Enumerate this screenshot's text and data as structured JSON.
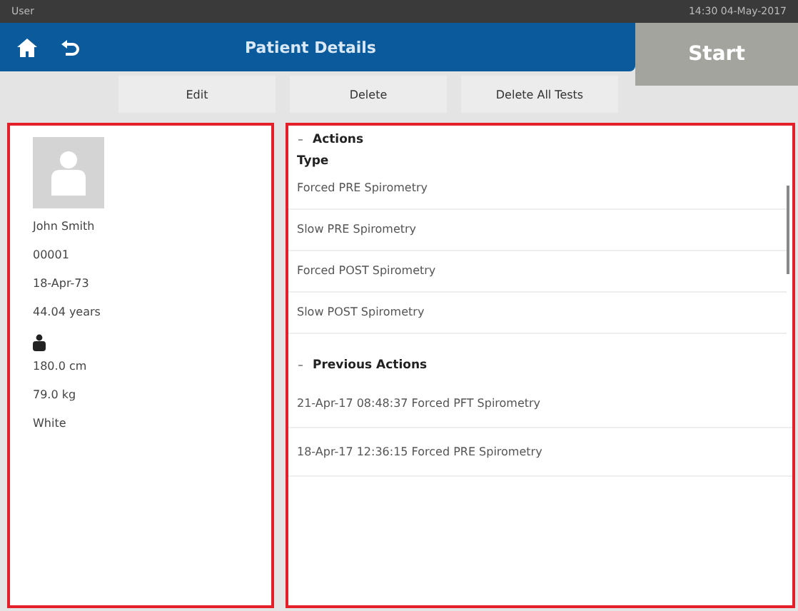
{
  "status_bar": {
    "user": "User",
    "datetime": "14:30 04-May-2017"
  },
  "header": {
    "title": "Patient Details",
    "start_button": {
      "label": "Start",
      "disabled": true
    }
  },
  "toolbar": [
    "Edit",
    "Delete",
    "Delete All Tests"
  ],
  "patient": {
    "name": "John Smith",
    "id": "00001",
    "birth_date": "18-Apr-73",
    "age": "44.04 years",
    "height": "180.0 cm",
    "weight": "79.0 kg",
    "ethnicity": "White"
  },
  "actions": {
    "title": "Actions",
    "column": "Type",
    "items": [
      "Forced PRE Spirometry",
      "Slow PRE Spirometry",
      "Forced POST Spirometry",
      "Slow POST Spirometry"
    ]
  },
  "previous_actions": {
    "title": "Previous Actions",
    "items": [
      "21-Apr-17 08:48:37 Forced PFT Spirometry",
      "18-Apr-17 12:36:15 Forced PRE Spirometry"
    ]
  }
}
